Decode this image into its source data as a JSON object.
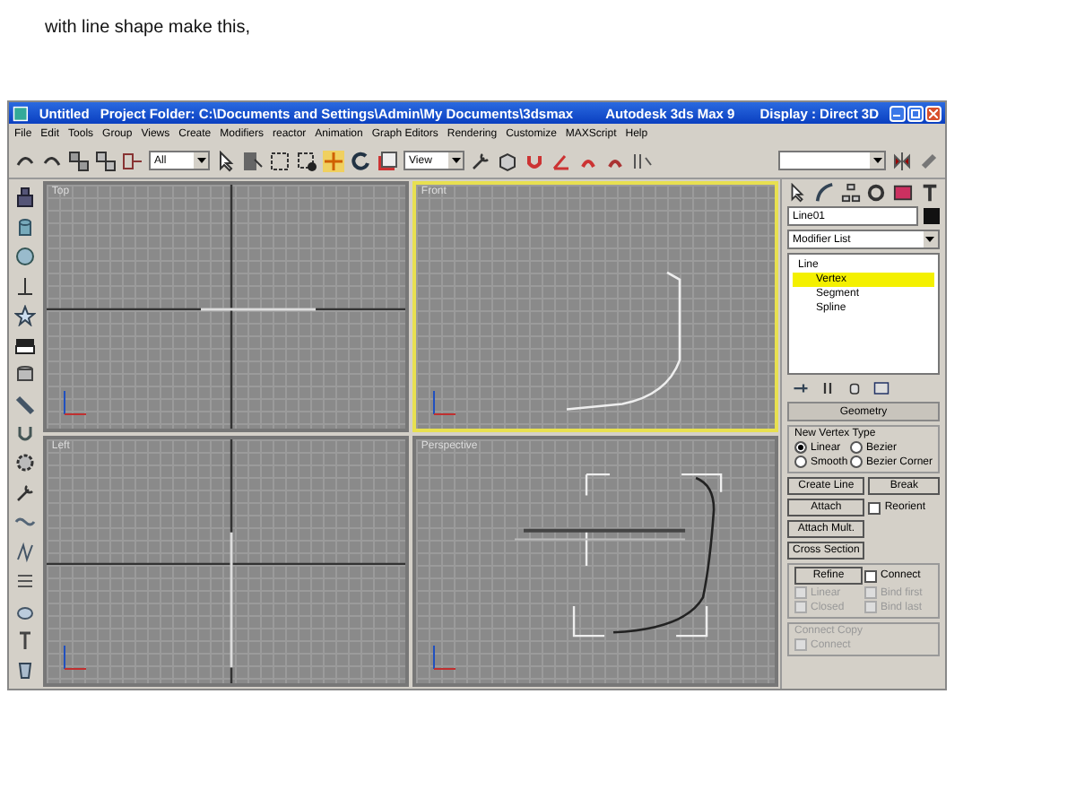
{
  "caption": "with line shape make this,",
  "window": {
    "title": "Untitled",
    "project": "Project Folder: C:\\Documents and Settings\\Admin\\My Documents\\3dsmax",
    "app": "Autodesk 3ds Max 9",
    "display": "Display : Direct 3D"
  },
  "menu": [
    "File",
    "Edit",
    "Tools",
    "Group",
    "Views",
    "Create",
    "Modifiers",
    "reactor",
    "Animation",
    "Graph Editors",
    "Rendering",
    "Customize",
    "MAXScript",
    "Help"
  ],
  "toolbar": {
    "selection_filter": "All",
    "reference_coord": "View"
  },
  "viewports": [
    {
      "label": "Top",
      "selected": false,
      "kind": "top"
    },
    {
      "label": "Front",
      "selected": true,
      "kind": "front"
    },
    {
      "label": "Left",
      "selected": false,
      "kind": "left"
    },
    {
      "label": "Perspective",
      "selected": false,
      "kind": "perspective"
    }
  ],
  "command_panel": {
    "object_name": "Line01",
    "modifier_list": "Modifier List",
    "stack": [
      {
        "label": "Line",
        "children": [
          {
            "label": "Vertex",
            "selected": true
          },
          {
            "label": "Segment",
            "selected": false
          },
          {
            "label": "Spline",
            "selected": false
          }
        ]
      }
    ],
    "geometry": {
      "title": "Geometry",
      "vertex_type_title": "New Vertex Type",
      "vertex_types": [
        {
          "label": "Linear",
          "selected": true
        },
        {
          "label": "Bezier",
          "selected": false
        },
        {
          "label": "Smooth",
          "selected": false
        },
        {
          "label": "Bezier Corner",
          "selected": false
        }
      ],
      "buttons": [
        {
          "label": "Create Line"
        },
        {
          "label": "Break"
        },
        {
          "label": "Attach"
        },
        {
          "label": "Attach Mult."
        },
        {
          "label": "Cross Section"
        }
      ],
      "reorient": {
        "label": "Reorient",
        "checked": false
      },
      "refine": "Refine",
      "refine_options": [
        {
          "label": "Connect",
          "checked": false,
          "disabled": false
        },
        {
          "label": "Linear",
          "checked": false,
          "disabled": true
        },
        {
          "label": "Bind first",
          "checked": false,
          "disabled": true
        },
        {
          "label": "Closed",
          "checked": false,
          "disabled": true
        },
        {
          "label": "Bind last",
          "checked": false,
          "disabled": true
        }
      ],
      "connect_copy_title": "Connect Copy",
      "connect_copy": {
        "label": "Connect",
        "checked": false,
        "disabled": true
      }
    }
  }
}
